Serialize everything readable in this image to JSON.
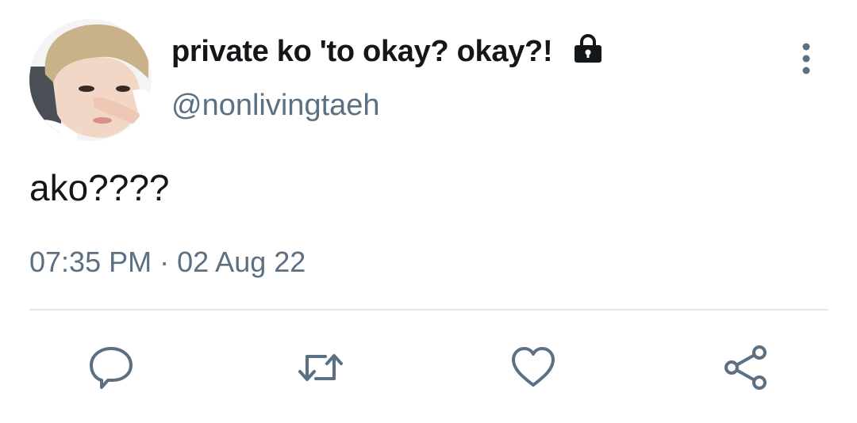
{
  "tweet": {
    "display_name": "private ko 'to okay? okay?!",
    "handle": "@nonlivingtaeh",
    "text": "ako????",
    "time": "07:35 PM",
    "separator": "·",
    "date": "02 Aug 22"
  },
  "icons": {
    "lock": "lock-icon",
    "more": "more-vertical-icon",
    "reply": "reply-icon",
    "retweet": "retweet-icon",
    "like": "heart-icon",
    "share": "share-icon"
  },
  "colors": {
    "name": "#14171a",
    "secondary": "#5b7083",
    "divider": "#e1e8ed"
  }
}
